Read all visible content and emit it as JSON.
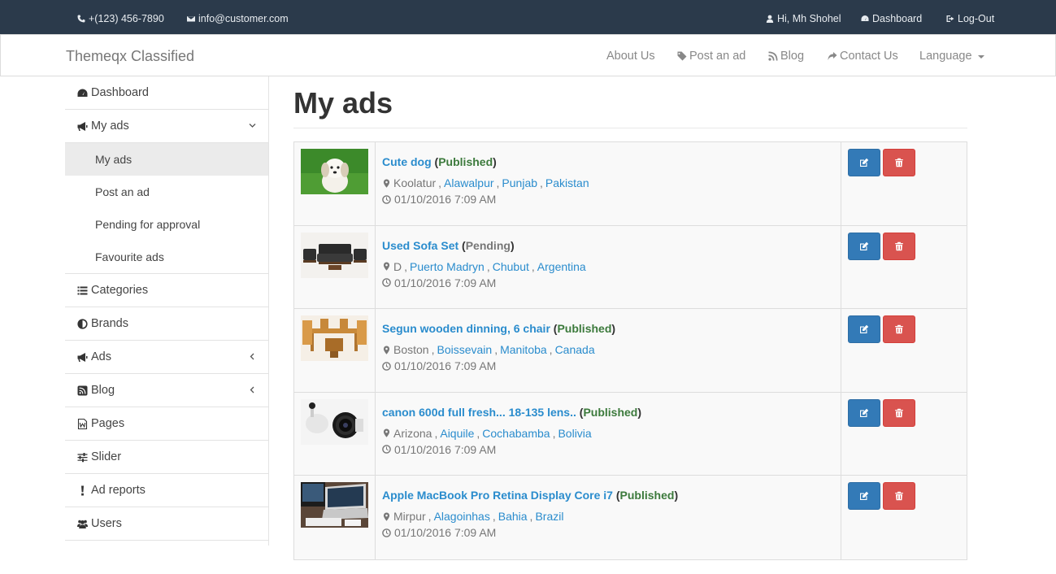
{
  "topbar": {
    "phone": "+(123) 456-7890",
    "email": "info@customer.com",
    "greeting": "Hi, Mh Shohel",
    "dashboard": "Dashboard",
    "logout": "Log-Out"
  },
  "navbar": {
    "brand": "Themeqx Classified",
    "about": "About Us",
    "post_ad": "Post an ad",
    "blog": "Blog",
    "contact": "Contact Us",
    "language": "Language"
  },
  "sidebar": {
    "dashboard": "Dashboard",
    "my_ads": "My ads",
    "sub": [
      "My ads",
      "Post an ad",
      "Pending for approval",
      "Favourite ads"
    ],
    "categories": "Categories",
    "brands": "Brands",
    "ads": "Ads",
    "blog": "Blog",
    "pages": "Pages",
    "slider": "Slider",
    "ad_reports": "Ad reports",
    "users": "Users"
  },
  "main": {
    "title": "My ads",
    "ads": [
      {
        "title": "Cute dog",
        "status": "Published",
        "city": "Koolatur",
        "area": "Alawalpur",
        "state": "Punjab",
        "country": "Pakistan",
        "date": "01/10/2016 7:09 AM"
      },
      {
        "title": "Used Sofa Set",
        "status": "Pending",
        "city": "D",
        "area": "Puerto Madryn",
        "state": "Chubut",
        "country": "Argentina",
        "date": "01/10/2016 7:09 AM"
      },
      {
        "title": "Segun wooden dinning, 6 chair",
        "status": "Published",
        "city": "Boston",
        "area": "Boissevain",
        "state": "Manitoba",
        "country": "Canada",
        "date": "01/10/2016 7:09 AM"
      },
      {
        "title": "canon 600d full fresh... 18-135 lens..",
        "status": "Published",
        "city": "Arizona",
        "area": "Aiquile",
        "state": "Cochabamba",
        "country": "Bolivia",
        "date": "01/10/2016 7:09 AM"
      },
      {
        "title": "Apple MacBook Pro Retina Display Core i7",
        "status": "Published",
        "city": "Mirpur",
        "area": "Alagoinhas",
        "state": "Bahia",
        "country": "Brazil",
        "date": "01/10/2016 7:09 AM"
      }
    ]
  },
  "colors": {
    "topbar_bg": "#2b3a4b",
    "link": "#2a8ccd",
    "published": "#3c7a3c",
    "edit_btn": "#337ab7",
    "delete_btn": "#d9534f"
  }
}
